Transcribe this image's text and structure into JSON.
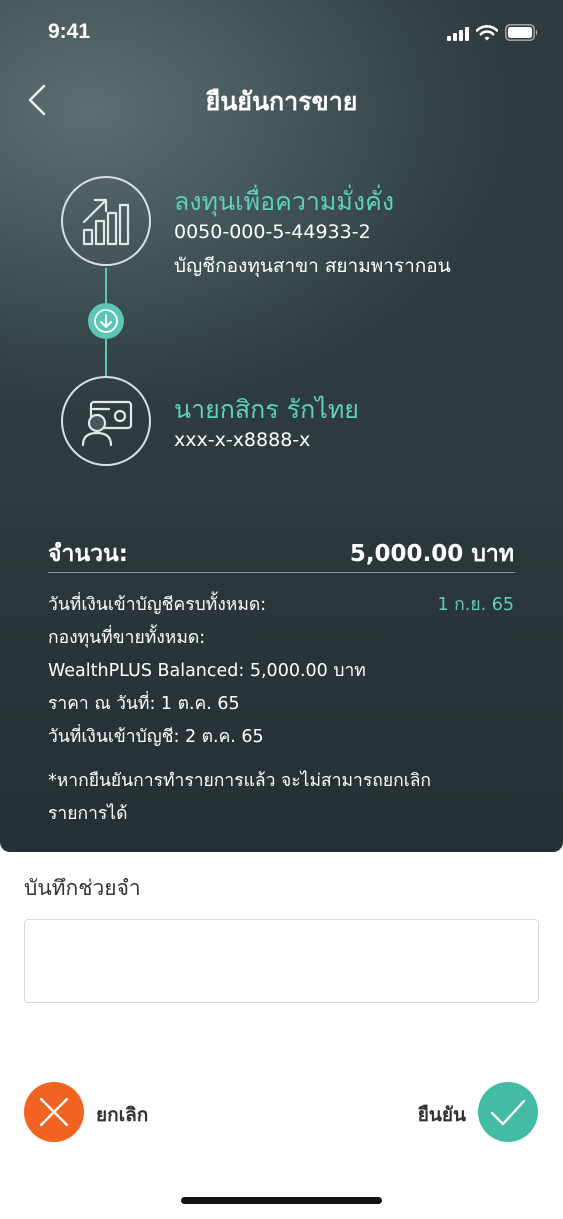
{
  "status_bar": {
    "time": "9:41"
  },
  "header": {
    "title": "ยืนยันการขาย"
  },
  "transfer": {
    "from": {
      "name": "ลงทุนเพื่อความมั่งคั่ง",
      "account": "0050-000-5-44933-2",
      "branch": "บัญชีกองทุนสาขา สยามพารากอน",
      "icon": "growth-chart-icon"
    },
    "to": {
      "name": "นายกสิกร รักไทย",
      "account": "xxx-x-x8888-x",
      "icon": "user-card-icon"
    }
  },
  "summary": {
    "amount_label": "จำนวน:",
    "amount_value": "5,000.00 บาท",
    "settle_label": "วันที่เงินเข้าบัญชีครบทั้งหมด:",
    "settle_value": "1 ก.ย. 65",
    "funds_label": "กองทุนที่ขายทั้งหมด:",
    "fund_line": "WealthPLUS Balanced: 5,000.00 บาท",
    "price_date": "ราคา ณ วันที่: 1 ต.ค. 65",
    "deposit_date": "วันที่เงินเข้าบัญชี: 2 ต.ค. 65",
    "note_line1": "*หากยืนยันการทำรายการแล้ว จะไม่สามารถยกเลิก",
    "note_line2": "รายการได้"
  },
  "memo": {
    "label": "บันทึกช่วยจำ",
    "value": ""
  },
  "actions": {
    "cancel_label": "ยกเลิก",
    "confirm_label": "ยืนยัน"
  },
  "colors": {
    "accent": "#5fd0bb",
    "cancel": "#f26322",
    "confirm": "#44bba4",
    "panel": "#2c393c"
  }
}
